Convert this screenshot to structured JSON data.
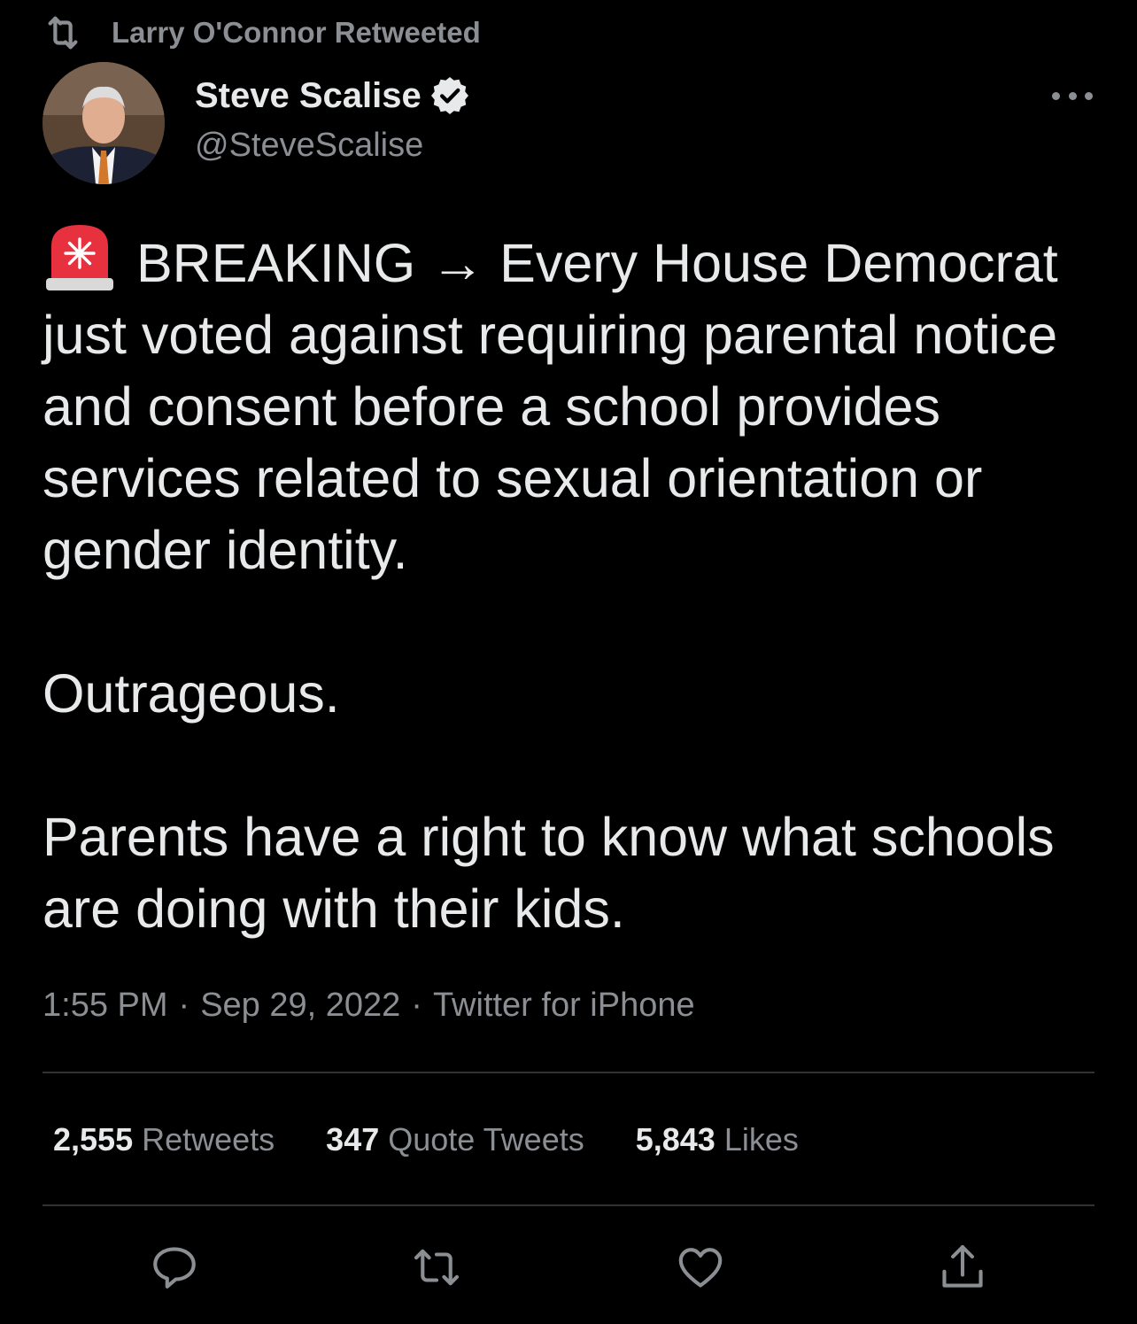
{
  "retweet_context": {
    "label": "Larry O'Connor Retweeted",
    "icon": "retweet-icon"
  },
  "author": {
    "display_name": "Steve Scalise",
    "handle": "@SteveScalise",
    "verified": true,
    "verified_icon": "verified-badge-icon"
  },
  "tweet": {
    "emoji": "siren-emoji",
    "paragraphs": [
      "BREAKING → Every House Democrat just voted against requiring parental notice and consent before a school provides services related to sexual orientation or gender identity.",
      "Outrageous.",
      "Parents have a right to know what schools are doing with their kids."
    ]
  },
  "meta": {
    "time": "1:55 PM",
    "date": "Sep 29, 2022",
    "source": "Twitter for iPhone",
    "separator": "·"
  },
  "stats": {
    "retweets_count": "2,555",
    "retweets_label": "Retweets",
    "quotes_count": "347",
    "quotes_label": "Quote Tweets",
    "likes_count": "5,843",
    "likes_label": "Likes"
  },
  "actions": [
    "reply-icon",
    "retweet-icon",
    "like-icon",
    "share-icon"
  ],
  "colors": {
    "background": "#000000",
    "text_primary": "#e7e9ea",
    "text_secondary": "#8b8f94",
    "divider": "#2f3336"
  }
}
